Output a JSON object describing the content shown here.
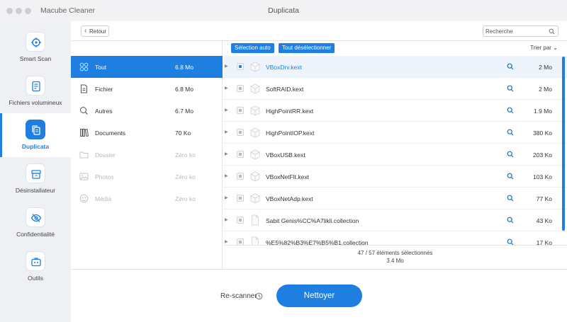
{
  "app": {
    "name": "Macube Cleaner",
    "window_title": "Duplicata"
  },
  "colors": {
    "accent": "#1e7fe0",
    "sidebar_bg": "#eef0f4"
  },
  "sidebar": {
    "items": [
      {
        "label": "Smart Scan",
        "icon": "target-icon",
        "active": false
      },
      {
        "label": "Fichiers volumineux",
        "icon": "document-icon",
        "active": false
      },
      {
        "label": "Duplicata",
        "icon": "copy-icon",
        "active": true
      },
      {
        "label": "Désinstallateur",
        "icon": "box-icon",
        "active": false
      },
      {
        "label": "Confidentialité",
        "icon": "eye-off-icon",
        "active": false
      },
      {
        "label": "Outils",
        "icon": "toolbox-icon",
        "active": false
      }
    ]
  },
  "toolbar": {
    "back_label": "Retour",
    "search_placeholder": "Recherche"
  },
  "categories": [
    {
      "name": "Tout",
      "size": "6.8 Mo",
      "icon": "grid-icon",
      "active": true,
      "disabled": false
    },
    {
      "name": "Fichier",
      "size": "6.8 Mo",
      "icon": "file-icon",
      "active": false,
      "disabled": false
    },
    {
      "name": "Autres",
      "size": "6.7 Mo",
      "icon": "search-doc-icon",
      "active": false,
      "disabled": false
    },
    {
      "name": "Documents",
      "size": "70 Ko",
      "icon": "books-icon",
      "active": false,
      "disabled": false
    },
    {
      "name": "Dossier",
      "size": "Zéro ko",
      "icon": "folder-icon",
      "active": false,
      "disabled": true
    },
    {
      "name": "Photos",
      "size": "Zéro ko",
      "icon": "image-icon",
      "active": false,
      "disabled": true
    },
    {
      "name": "Média",
      "size": "Zéro ko",
      "icon": "media-icon",
      "active": false,
      "disabled": true
    }
  ],
  "files_header": {
    "auto_select_label": "Sélection auto",
    "deselect_all_label": "Tout désélectionner",
    "sort_label": "Trier par"
  },
  "files": [
    {
      "name": "VBoxDrv.kext",
      "size": "2 Mo",
      "selected": true
    },
    {
      "name": "SoftRAID.kext",
      "size": "2 Mo",
      "selected": false
    },
    {
      "name": "HighPointRR.kext",
      "size": "1.9 Mo",
      "selected": false
    },
    {
      "name": "HighPointIOP.kext",
      "size": "380 Ko",
      "selected": false
    },
    {
      "name": "VBoxUSB.kext",
      "size": "203 Ko",
      "selected": false
    },
    {
      "name": "VBoxNetFlt.kext",
      "size": "103 Ko",
      "selected": false
    },
    {
      "name": "VBoxNetAdp.kext",
      "size": "77 Ko",
      "selected": false
    },
    {
      "name": "Sabit Genis%CC%A7likli.collection",
      "size": "43 Ko",
      "selected": false
    },
    {
      "name": "%E5%82%B3%E7%B5%B1.collection",
      "size": "17 Ko",
      "selected": false
    }
  ],
  "footer": {
    "selected_count": "47 / 57 éléments sélectionnés",
    "selected_size": "3.4 Mo"
  },
  "bottom": {
    "rescan_label": "Re-scanner",
    "clean_label": "Nettoyer"
  }
}
